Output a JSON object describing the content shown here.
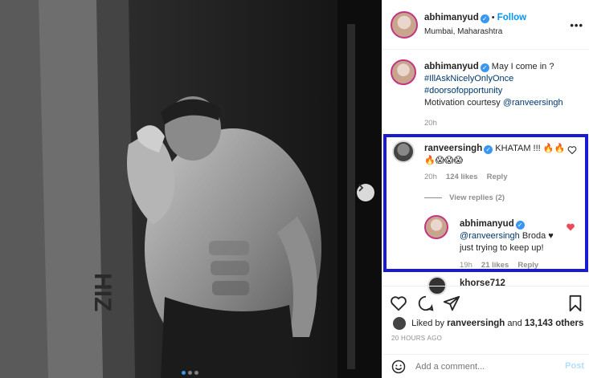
{
  "post": {
    "username": "abhimanyud",
    "follow_label": "Follow",
    "location": "Mumbai, Maharashtra",
    "more_label": "•••"
  },
  "caption": {
    "username": "abhimanyud",
    "text": "May I come in ?",
    "hashtag1": "#IllAskNicelyOnlyOnce",
    "hashtag2": "#doorsofopportunity",
    "motivation_prefix": "Motivation courtesy",
    "mention": "@ranveersingh",
    "time": "20h"
  },
  "comment1": {
    "username": "ranveersingh",
    "text": "KHATAM !!! 🔥🔥",
    "text2": "🔥😱😱😱",
    "time": "20h",
    "likes": "124 likes",
    "reply_label": "Reply",
    "view_replies": "View replies (2)"
  },
  "reply1": {
    "username": "abhimanyud",
    "mention": "@ranveersingh",
    "text": "Broda ♥",
    "text2": "just trying to keep up!",
    "time": "19h",
    "likes": "21 likes",
    "reply_label": "Reply"
  },
  "comment2": {
    "username": "khorse712"
  },
  "actions": {
    "liked_by_prefix": "Liked by",
    "liked_by_user": "ranveersingh",
    "liked_by_and": "and",
    "liked_by_count": "13,143 others",
    "timestamp": "20 HOURS AGO"
  },
  "add_comment": {
    "placeholder": "Add a comment...",
    "post_label": "Post"
  },
  "colors": {
    "accent": "#0095f6",
    "highlight_box": "#1a1ad4",
    "liked_heart": "#ed4956"
  }
}
